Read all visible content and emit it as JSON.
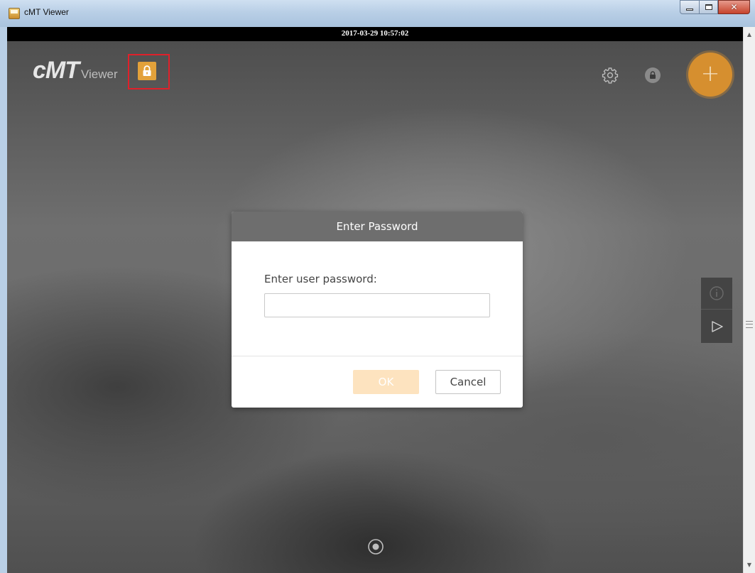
{
  "window": {
    "title": "cMT Viewer",
    "icon": "app-icon",
    "controls": {
      "minimize": "minimize-icon",
      "maximize": "maximize-icon",
      "close": "close-icon"
    }
  },
  "status_bar": {
    "datetime": "2017-03-29 10:57:02"
  },
  "header": {
    "logo_main": "cMT",
    "logo_sub": "Viewer",
    "lock_icon": "lock-icon",
    "settings_icon": "gear-icon",
    "account_lock_icon": "lock-icon",
    "add_icon": "plus-icon",
    "add_label": "+"
  },
  "side_panel": {
    "info_icon": "info-icon",
    "play_icon": "play-icon"
  },
  "dialog": {
    "title": "Enter Password",
    "prompt": "Enter user password:",
    "password_value": "",
    "ok_label": "OK",
    "cancel_label": "Cancel"
  },
  "colors": {
    "accent": "#d68f2f",
    "lock_button": "#e3a13a",
    "ok_button_disabled": "#fde3bf",
    "dialog_header": "#6e6e6e",
    "highlight": "#e0202a"
  }
}
